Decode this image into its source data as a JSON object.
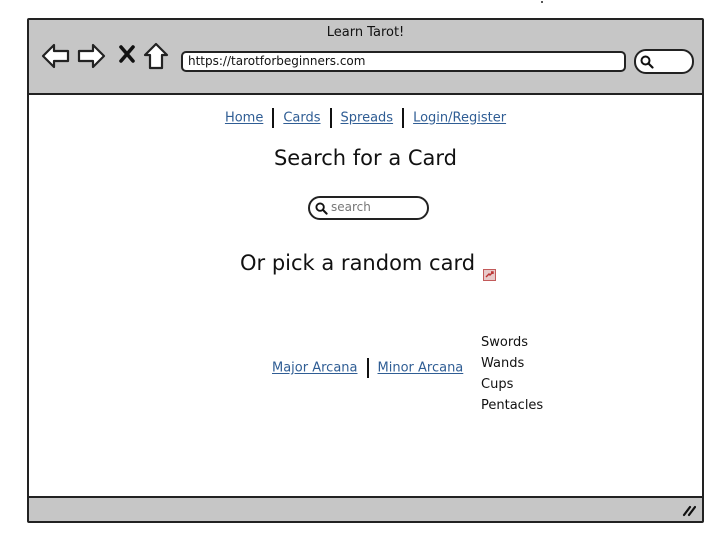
{
  "window": {
    "title": "Learn Tarot!",
    "url": "https://tarotforbeginners.com"
  },
  "nav": {
    "items": [
      {
        "label": "Home"
      },
      {
        "label": "Cards"
      },
      {
        "label": "Spreads"
      },
      {
        "label": "Login/Register"
      }
    ]
  },
  "main": {
    "search_heading": "Search for a Card",
    "search_placeholder": "search",
    "random_heading": "Or pick a random card",
    "arcana": [
      "Major Arcana",
      "Minor Arcana"
    ],
    "suits": [
      "Swords",
      "Wands",
      "Cups",
      "Pentacles"
    ]
  },
  "icons": {
    "back": "back-arrow-icon",
    "forward": "forward-arrow-icon",
    "stop": "close-icon",
    "home": "home-icon",
    "search": "search-icon",
    "random": "shuffle-icon",
    "resize": "resize-grip-icon"
  },
  "colors": {
    "chrome": "#c6c6c6",
    "link": "#2f5d94",
    "outline": "#222222"
  }
}
